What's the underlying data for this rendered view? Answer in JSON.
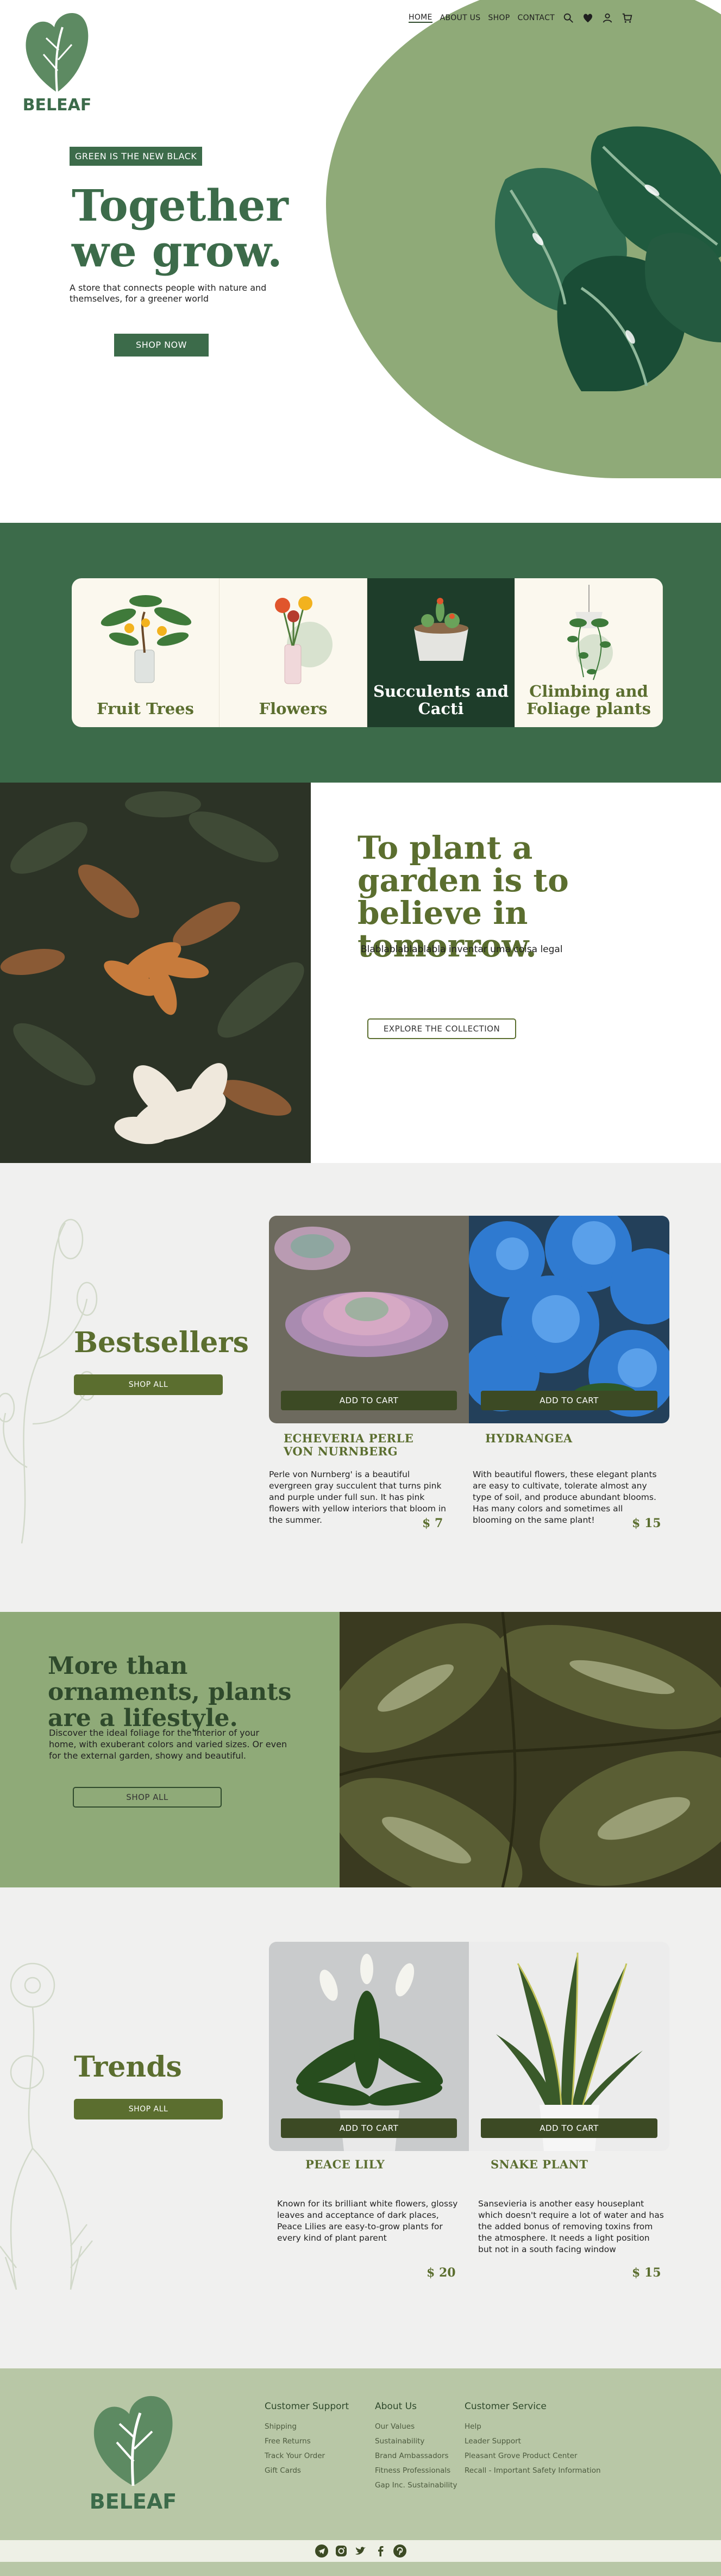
{
  "brand": {
    "name": "BELEAF"
  },
  "nav": {
    "items": [
      "HOME",
      "ABOUT US",
      "SHOP",
      "CONTACT"
    ]
  },
  "icons": [
    "search-icon",
    "heart-icon",
    "user-icon",
    "cart-icon"
  ],
  "hero": {
    "badge": "GREEN IS THE NEW BLACK",
    "title": "Together we grow.",
    "subtitle": "A store that connects people with nature and themselves, for a greener world",
    "button": "SHOP NOW"
  },
  "categories": [
    {
      "label": "Fruit Trees"
    },
    {
      "label": "Flowers"
    },
    {
      "label": "Succulents and Cacti"
    },
    {
      "label": "Climbing and Foliage plants"
    }
  ],
  "garden": {
    "title": "To plant a garden is to believe in tomorrow.",
    "subtitle": "Blablablablablabla inventar uma coisa legal",
    "button": "EXPLORE THE COLLECTION"
  },
  "bestsellers": {
    "title": "Bestsellers",
    "button": "SHOP ALL",
    "products": [
      {
        "name": "ECHEVERIA PERLE VON NURNBERG",
        "desc": "Perle von Nurnberg' is a beautiful evergreen gray succulent that turns pink and purple under full sun. It has pink flowers with yellow interiors that bloom in the summer.",
        "price": "$ 7",
        "cta": "ADD TO CART"
      },
      {
        "name": "HYDRANGEA",
        "desc": "With beautiful flowers, these elegant plants are easy to cultivate, tolerate almost any type of soil, and produce abundant blooms. Has many colors and sometimes all blooming on the same plant!",
        "price": "$ 15",
        "cta": "ADD TO CART"
      }
    ]
  },
  "lifestyle": {
    "title": "More than ornaments, plants are a lifestyle.",
    "subtitle": "Discover the ideal foliage for the interior of your home, with exuberant colors and varied sizes. Or even for the external garden, showy and beautiful.",
    "button": "SHOP ALL"
  },
  "trends": {
    "title": "Trends",
    "button": "SHOP ALL",
    "products": [
      {
        "name": "PEACE LILY",
        "desc": "Known for its brilliant white flowers, glossy leaves and acceptance of dark places, Peace Lilies are easy-to-grow plants for every kind of plant parent",
        "price": "$ 20",
        "cta": "ADD TO CART"
      },
      {
        "name": "SNAKE PLANT",
        "desc": "Sansevieria is another easy houseplant which doesn't require a lot of water and has the added bonus of removing toxins from the atmosphere. It needs a light position but not in a south facing window",
        "price": "$ 15",
        "cta": "ADD TO CART"
      }
    ]
  },
  "footer": {
    "columns": [
      {
        "title": "Customer Support",
        "links": [
          "Shipping",
          "Free Returns",
          "Track Your Order",
          "Gift Cards"
        ]
      },
      {
        "title": "About Us",
        "links": [
          "Our Values",
          "Sustainability",
          "Brand Ambassadors",
          "Fitness Professionals",
          "Gap Inc. Sustainability"
        ]
      },
      {
        "title": "Customer Service",
        "links": [
          "Help",
          "Leader Support",
          "Pleasant Grove Product Center",
          "Recall - Important Safety Information"
        ]
      }
    ],
    "social": [
      "telegram-icon",
      "instagram-icon",
      "twitter-icon",
      "facebook-icon",
      "pinterest-icon"
    ]
  },
  "colors": {
    "primary_green": "#3c6b4a",
    "sage": "#8faa78",
    "olive": "#5b6e2f",
    "footer_bg": "#b8c7a6",
    "section_grey": "#f0f0ef"
  }
}
